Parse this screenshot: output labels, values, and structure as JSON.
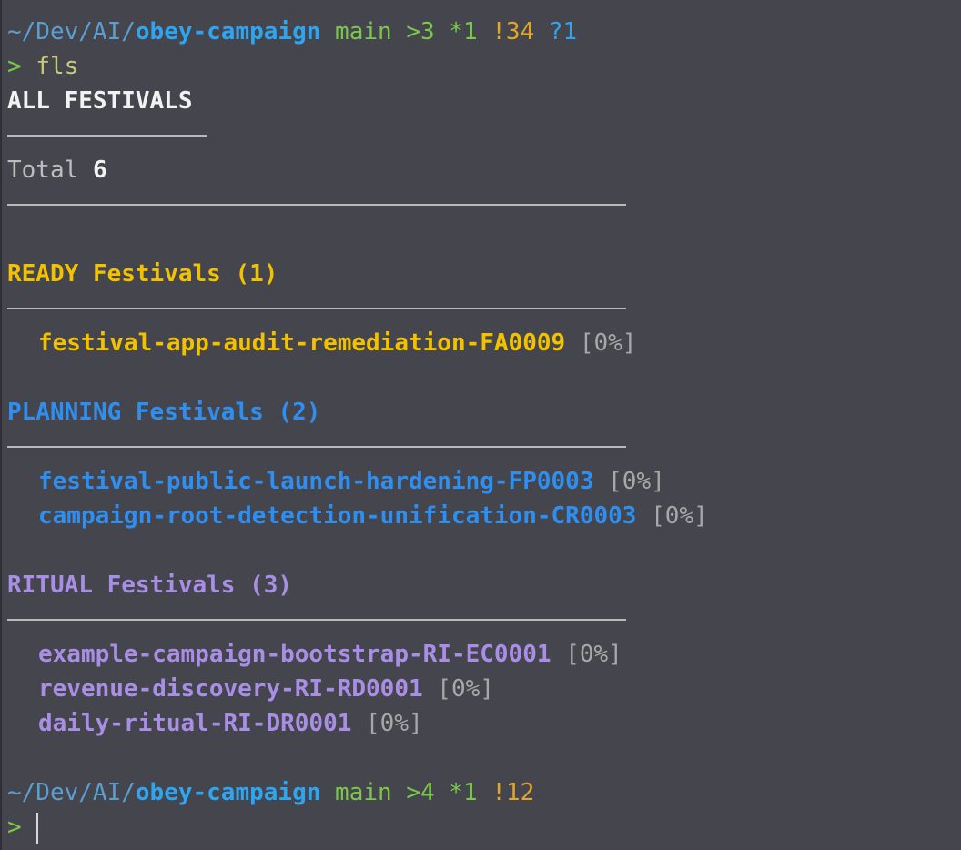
{
  "prompt1": {
    "path_prefix": "~/Dev/AI/",
    "repo": "obey-campaign",
    "branch": "main",
    "ahead": ">3",
    "stash": "*1",
    "modified": "!34",
    "untracked": "?1"
  },
  "command": {
    "prompt_char": ">",
    "text": "fls"
  },
  "output": {
    "title": "ALL FESTIVALS",
    "total_label": "Total",
    "total_value": "6",
    "groups": [
      {
        "status": "READY",
        "label": "Festivals",
        "count": "(1)",
        "items": [
          {
            "name": "festival-app-audit-remediation-FA0009",
            "progress": "[0%]"
          }
        ]
      },
      {
        "status": "PLANNING",
        "label": "Festivals",
        "count": "(2)",
        "items": [
          {
            "name": "festival-public-launch-hardening-FP0003",
            "progress": "[0%]"
          },
          {
            "name": "campaign-root-detection-unification-CR0003",
            "progress": "[0%]"
          }
        ]
      },
      {
        "status": "RITUAL",
        "label": "Festivals",
        "count": "(3)",
        "items": [
          {
            "name": "example-campaign-bootstrap-RI-EC0001",
            "progress": "[0%]"
          },
          {
            "name": "revenue-discovery-RI-RD0001",
            "progress": "[0%]"
          },
          {
            "name": "daily-ritual-RI-DR0001",
            "progress": "[0%]"
          }
        ]
      }
    ]
  },
  "prompt2": {
    "path_prefix": "~/Dev/AI/",
    "repo": "obey-campaign",
    "branch": "main",
    "ahead": ">4",
    "stash": "*1",
    "modified": "!12"
  },
  "prompt3": {
    "prompt_char": ">"
  },
  "colors": {
    "background": "#45454d",
    "ready": "#f2c200",
    "planning": "#2f8ff0",
    "ritual": "#a98ee6",
    "git_green": "#7ac84a",
    "git_orange": "#e0a72a",
    "repo_blue": "#2fa4f0"
  }
}
